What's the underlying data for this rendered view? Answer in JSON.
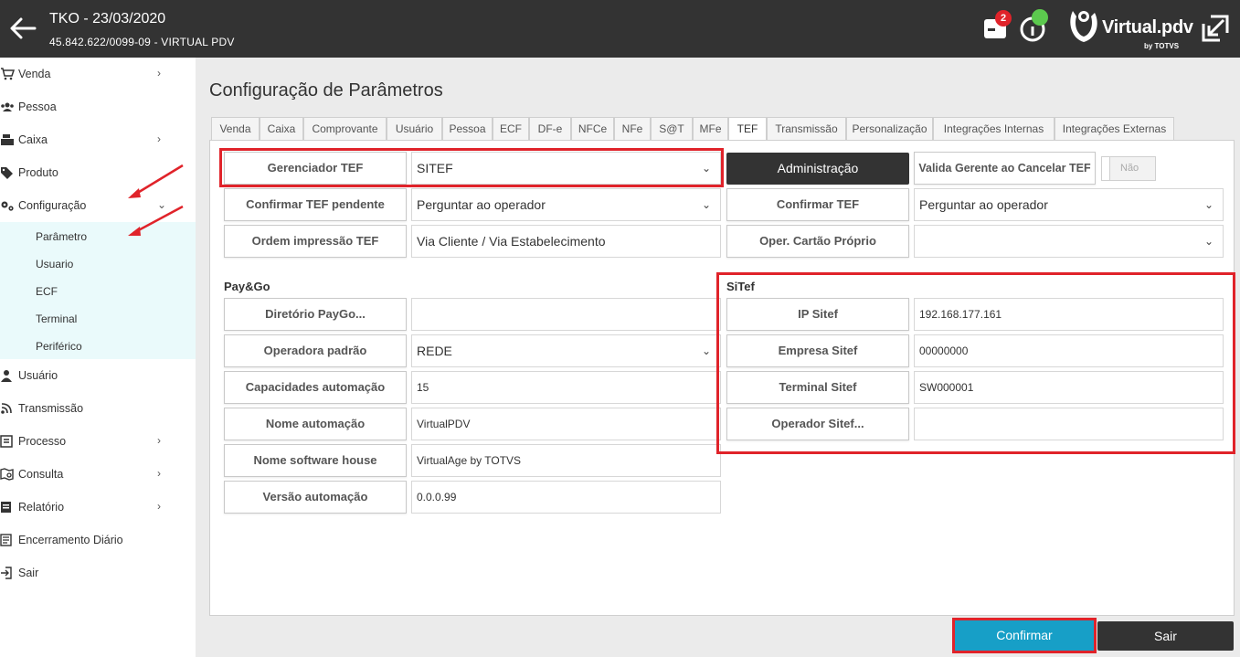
{
  "header": {
    "title": "TKO - 23/03/2020",
    "subtitle": "45.842.622/0099-09 - VIRTUAL PDV",
    "notification_count": "2",
    "logo_text": "Virtual.pdv",
    "logo_sub": "by TOTVS"
  },
  "sidebar": {
    "items": [
      {
        "label": "Venda",
        "icon": "cart-icon",
        "chevron": "›"
      },
      {
        "label": "Pessoa",
        "icon": "people-icon",
        "chevron": ""
      },
      {
        "label": "Caixa",
        "icon": "cash-register-icon",
        "chevron": "›"
      },
      {
        "label": "Produto",
        "icon": "tag-icon",
        "chevron": ""
      },
      {
        "label": "Configuração",
        "icon": "gears-icon",
        "chevron": "⌄"
      },
      {
        "label": "Usuário",
        "icon": "user-icon",
        "chevron": ""
      },
      {
        "label": "Transmissão",
        "icon": "signal-icon",
        "chevron": ""
      },
      {
        "label": "Processo",
        "icon": "process-icon",
        "chevron": "›"
      },
      {
        "label": "Consulta",
        "icon": "map-icon",
        "chevron": "›"
      },
      {
        "label": "Relatório",
        "icon": "report-icon",
        "chevron": "›"
      },
      {
        "label": "Encerramento Diário",
        "icon": "list-icon",
        "chevron": ""
      },
      {
        "label": "Sair",
        "icon": "exit-icon",
        "chevron": ""
      }
    ],
    "submenu": [
      "Parâmetro",
      "Usuario",
      "ECF",
      "Terminal",
      "Periférico"
    ]
  },
  "main": {
    "title": "Configuração de Parâmetros",
    "tabs": [
      "Venda",
      "Caixa",
      "Comprovante",
      "Usuário",
      "Pessoa",
      "ECF",
      "DF-e",
      "NFCe",
      "NFe",
      "S@T",
      "MFe",
      "TEF",
      "Transmissão",
      "Personalização",
      "Integrações Internas",
      "Integrações Externas"
    ],
    "active_tab": "TEF"
  },
  "tef": {
    "gerenciador_label": "Gerenciador TEF",
    "gerenciador_value": "SITEF",
    "admin_button": "Administração",
    "valida_gerente_label": "Valida Gerente ao Cancelar TEF",
    "valida_gerente_value": "Não",
    "confirmar_pendente_label": "Confirmar TEF pendente",
    "confirmar_pendente_value": "Perguntar ao operador",
    "confirmar_tef_label": "Confirmar TEF",
    "confirmar_tef_value": "Perguntar ao operador",
    "ordem_label": "Ordem impressão TEF",
    "ordem_value": "Via Cliente / Via Estabelecimento",
    "cartao_proprio_label": "Oper. Cartão Próprio",
    "cartao_proprio_value": ""
  },
  "paygo": {
    "section": "Pay&Go",
    "diretorio_label": "Diretório PayGo...",
    "diretorio_value": "",
    "operadora_label": "Operadora padrão",
    "operadora_value": "REDE",
    "capacidades_label": "Capacidades automação",
    "capacidades_value": "15",
    "nome_label": "Nome automação",
    "nome_value": "VirtualPDV",
    "software_label": "Nome software house",
    "software_value": "VirtualAge by TOTVS",
    "versao_label": "Versão automação",
    "versao_value": "0.0.0.99"
  },
  "sitef": {
    "section": "SiTef",
    "ip_label": "IP Sitef",
    "ip_value": "192.168.177.161",
    "empresa_label": "Empresa Sitef",
    "empresa_value": "00000000",
    "terminal_label": "Terminal Sitef",
    "terminal_value": "SW000001",
    "operador_label": "Operador Sitef...",
    "operador_value": ""
  },
  "footer": {
    "confirm_label": "Confirmar",
    "exit_label": "Sair"
  },
  "colors": {
    "header_bg": "#333333",
    "accent_blue": "#179fc7",
    "highlight_red": "#e0232a",
    "submenu_bg": "#eafafb",
    "status_green": "#5cc94e"
  },
  "caret": "⌄"
}
